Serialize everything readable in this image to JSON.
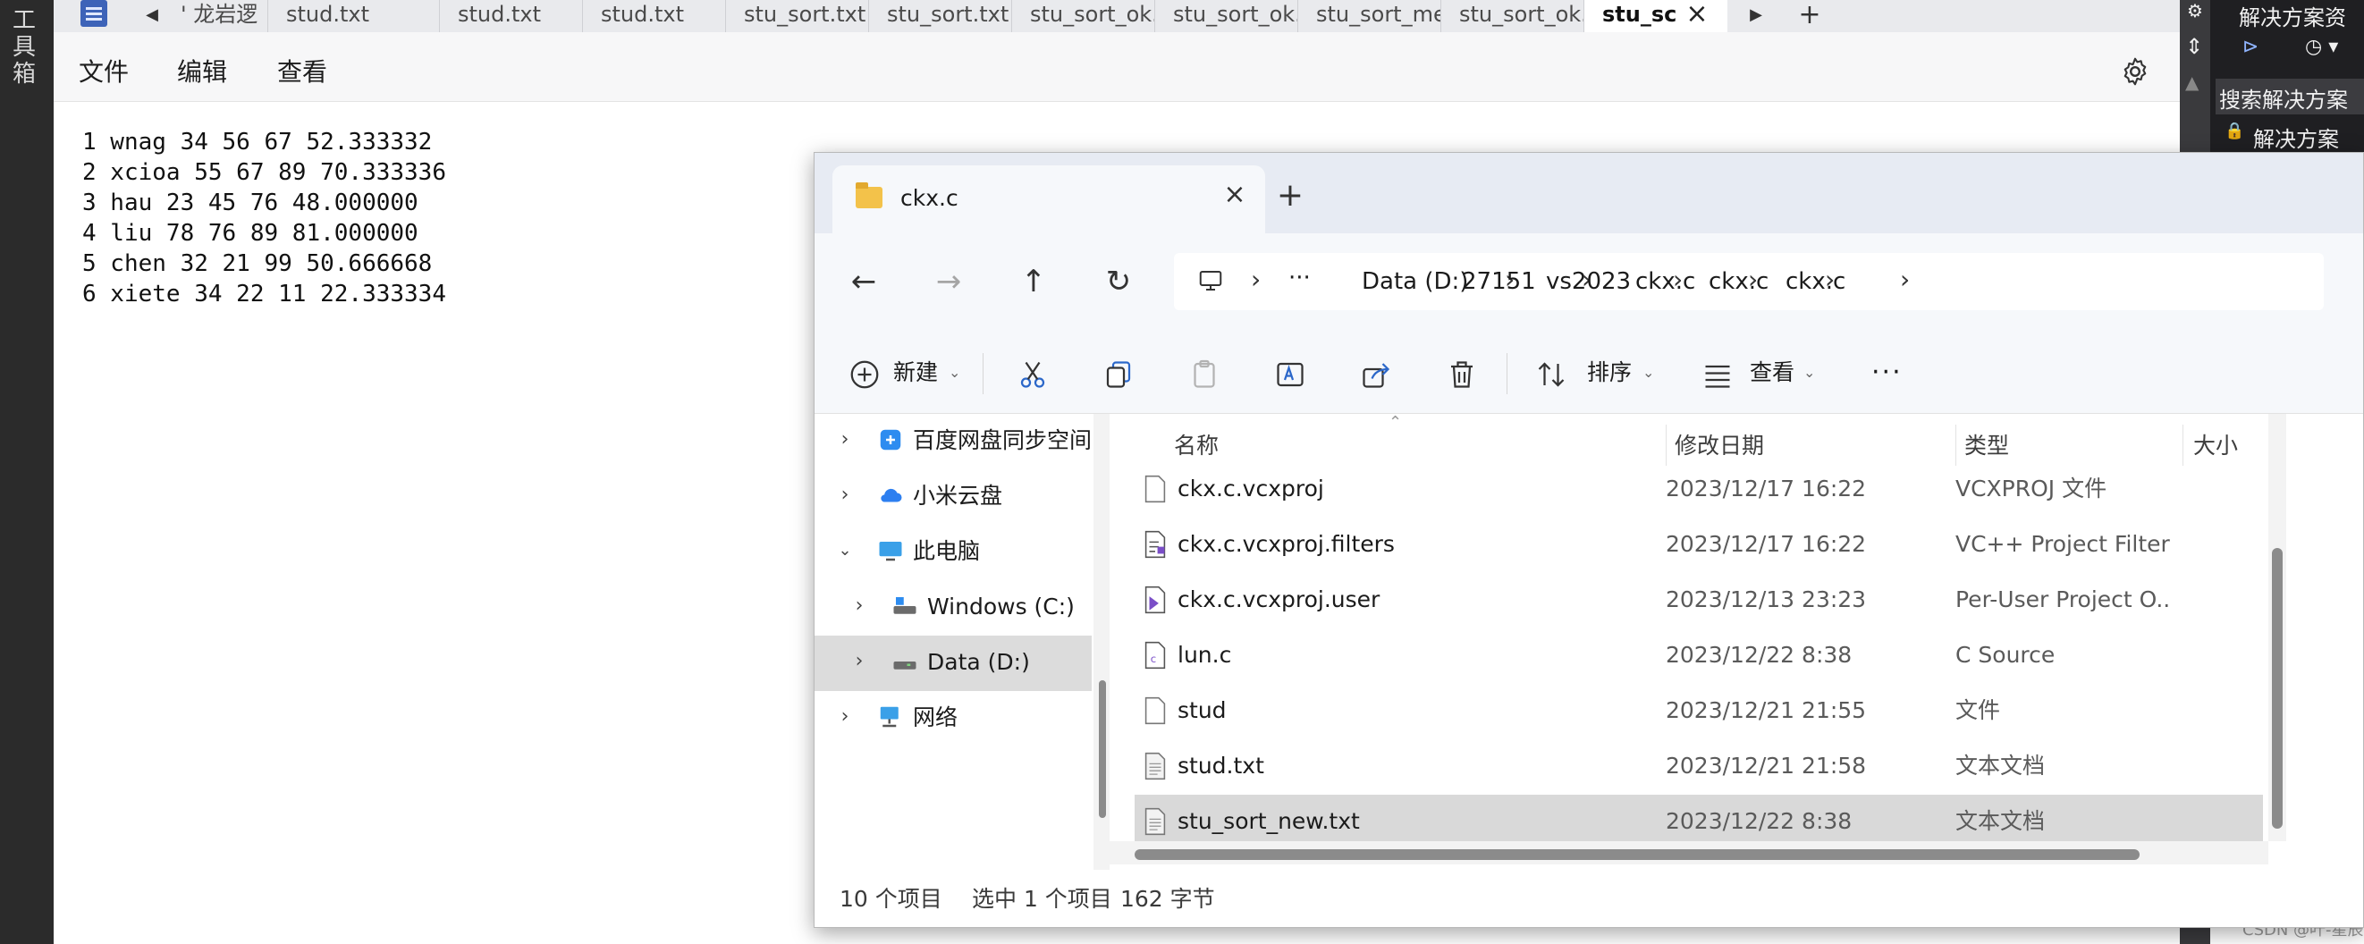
{
  "left_strip": {
    "label": "工具箱"
  },
  "notepad": {
    "tabs": [
      {
        "label": "' 龙岩逻"
      },
      {
        "label": "stud.txt"
      },
      {
        "label": "stud.txt"
      },
      {
        "label": "stud.txt"
      },
      {
        "label": "stu_sort.txt"
      },
      {
        "label": "stu_sort.txt"
      },
      {
        "label": "stu_sort_ok.t"
      },
      {
        "label": "stu_sort_ok.t"
      },
      {
        "label": "stu_sort_me"
      },
      {
        "label": "stu_sort_ok.t"
      },
      {
        "label": "stu_sc"
      }
    ],
    "menu": {
      "file": "文件",
      "edit": "编辑",
      "view": "查看"
    },
    "lines": [
      "1 wnag 34 56 67 52.333332",
      "2 xcioa 55 67 89 70.333336",
      "3 hau 23 45 76 48.000000",
      "4 liu 78 76 89 81.000000",
      "5 chen 32 21 99 50.666668",
      "6 xiete 34 22 11 22.333334"
    ]
  },
  "ide": {
    "title": "解决方案资",
    "search_label": "搜索解决方案",
    "solution_label": "解决方案",
    "watermark": "CSDN @叶-星辰"
  },
  "explorer": {
    "tab_title": "ckx.c",
    "breadcrumbs": [
      "Data (D:)",
      "27151",
      "vs2023",
      "ckx.c",
      "ckx.c",
      "ckx.c"
    ],
    "commands": {
      "new": "新建",
      "sort": "排序",
      "view": "查看"
    },
    "nav_items": [
      {
        "label": "百度网盘同步空间"
      },
      {
        "label": "小米云盘"
      },
      {
        "label": "此电脑"
      },
      {
        "label": "Windows (C:)"
      },
      {
        "label": "Data (D:)"
      },
      {
        "label": "网络"
      }
    ],
    "columns": {
      "name": "名称",
      "date": "修改日期",
      "type": "类型",
      "size": "大小"
    },
    "files": [
      {
        "name": "ckx.c.vcxproj",
        "date": "2023/12/17 16:22",
        "type": "VCXPROJ 文件",
        "icon": "file-icon"
      },
      {
        "name": "ckx.c.vcxproj.filters",
        "date": "2023/12/17 16:22",
        "type": "VC++ Project Filter...",
        "icon": "filters-file-icon"
      },
      {
        "name": "ckx.c.vcxproj.user",
        "date": "2023/12/13 23:23",
        "type": "Per-User Project O...",
        "icon": "vs-project-icon"
      },
      {
        "name": "lun.c",
        "date": "2023/12/22 8:38",
        "type": "C Source",
        "icon": "c-source-icon"
      },
      {
        "name": "stud",
        "date": "2023/12/21 21:55",
        "type": "文件",
        "icon": "file-icon"
      },
      {
        "name": "stud.txt",
        "date": "2023/12/21 21:58",
        "type": "文本文档",
        "icon": "text-file-icon"
      },
      {
        "name": "stu_sort_new.txt",
        "date": "2023/12/22 8:38",
        "type": "文本文档",
        "icon": "text-file-icon"
      }
    ],
    "status": {
      "count": "10 个项目",
      "selected": "选中 1 个项目",
      "size": "162 字节"
    }
  }
}
